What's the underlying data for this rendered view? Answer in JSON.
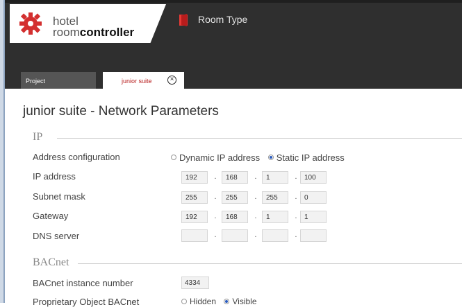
{
  "app": {
    "logo_line1": "hotel",
    "logo_line2_light": "room",
    "logo_line2_bold": "controller",
    "module_title": "Room Type",
    "brand_color": "#d32f2f"
  },
  "tabs": [
    {
      "label": "Project",
      "active": false
    },
    {
      "label": "junior suite",
      "active": true,
      "close_icon": "close-circle-icon"
    }
  ],
  "page": {
    "title": "junior suite - Network Parameters"
  },
  "ip_section": {
    "title": "IP",
    "address_config": {
      "label": "Address configuration",
      "options": [
        "Dynamic IP address",
        "Static IP address"
      ],
      "selected": "Static IP address"
    },
    "ip_address": {
      "label": "IP address",
      "octets": [
        "192",
        "168",
        "1",
        "100"
      ]
    },
    "subnet_mask": {
      "label": "Subnet mask",
      "octets": [
        "255",
        "255",
        "255",
        "0"
      ]
    },
    "gateway": {
      "label": "Gateway",
      "octets": [
        "192",
        "168",
        "1",
        "1"
      ]
    },
    "dns_server": {
      "label": "DNS server",
      "octets": [
        "",
        "",
        "",
        ""
      ]
    }
  },
  "bacnet_section": {
    "title": "BACnet",
    "instance_number": {
      "label": "BACnet instance number",
      "value": "4334"
    },
    "proprietary": {
      "label": "Proprietary Object BACnet",
      "options": [
        "Hidden",
        "Visible"
      ],
      "selected": "Visible"
    }
  }
}
